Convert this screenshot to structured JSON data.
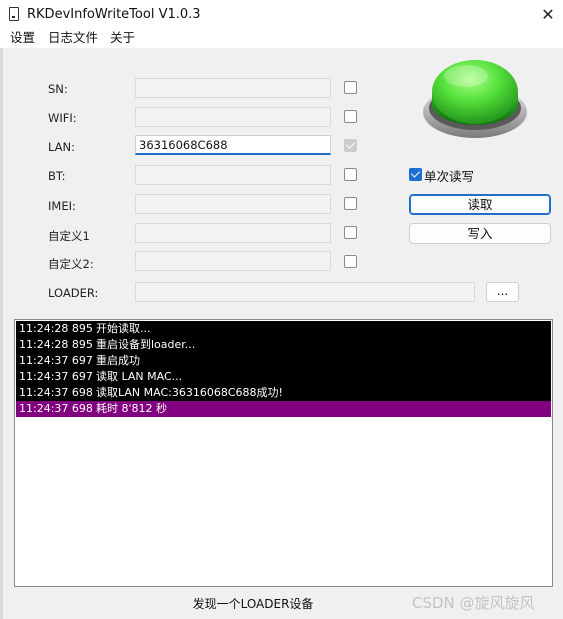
{
  "window": {
    "title": "RKDevInfoWriteTool V1.0.3",
    "close": "✕"
  },
  "menu": [
    "设置",
    "日志文件",
    "关于"
  ],
  "fields": [
    {
      "label": "SN:",
      "value": "",
      "checked": false
    },
    {
      "label": "WIFI:",
      "value": "",
      "checked": false
    },
    {
      "label": "LAN:",
      "value": "36316068C688",
      "checked": true
    },
    {
      "label": "BT:",
      "value": "",
      "checked": false
    },
    {
      "label": "IMEI:",
      "value": "",
      "checked": false
    },
    {
      "label": "自定义1",
      "value": "",
      "checked": false
    },
    {
      "label": "自定义2:",
      "value": "",
      "checked": false
    }
  ],
  "loader": {
    "label": "LOADER:",
    "value": "",
    "browse_label": "..."
  },
  "options": {
    "single_rw_label": "单次读写",
    "single_rw_checked": true
  },
  "buttons": {
    "read": "读取",
    "write": "写入"
  },
  "colors": {
    "accent": "#1e6fc8",
    "log_bg": "#000000",
    "log_highlight": "#800080",
    "go_button": "#3ed53a"
  },
  "log": [
    {
      "time": "11:24:28 895",
      "msg": "开始读取..."
    },
    {
      "time": "11:24:28 895",
      "msg": "重启设备到loader..."
    },
    {
      "time": "11:24:37 697",
      "msg": "重启成功"
    },
    {
      "time": "11:24:37 697",
      "msg": "读取 LAN MAC..."
    },
    {
      "time": "11:24:37 698",
      "msg": "读取LAN MAC:36316068C688成功!"
    },
    {
      "time": "11:24:37 698",
      "msg": "耗时 8'812 秒",
      "highlight": true
    }
  ],
  "status": "发现一个LOADER设备",
  "watermark": "CSDN @旋风旋风"
}
